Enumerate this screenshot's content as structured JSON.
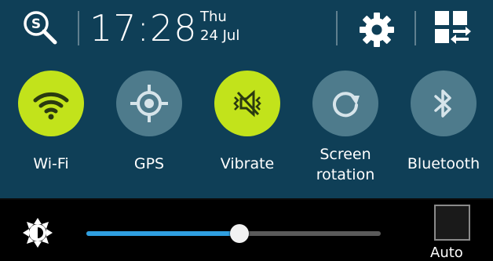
{
  "header": {
    "time": "17:28",
    "day": "Thu",
    "date": "24 Jul",
    "icons": [
      "search-icon",
      "settings-gear-icon",
      "edit-tiles-icon"
    ]
  },
  "quick_settings": [
    {
      "label": "Wi-Fi",
      "icon": "wifi-icon",
      "enabled": true
    },
    {
      "label": "GPS",
      "icon": "gps-icon",
      "enabled": false
    },
    {
      "label": "Vibrate",
      "icon": "vibrate-icon",
      "enabled": true
    },
    {
      "label_line1": "Screen",
      "label_line2": "rotation",
      "icon": "screen-rotation-icon",
      "enabled": false
    },
    {
      "label": "Bluetooth",
      "icon": "bluetooth-icon",
      "enabled": false
    }
  ],
  "brightness": {
    "icon": "brightness-icon",
    "level_fraction": 0.52,
    "auto_label": "Auto",
    "auto_checked": false
  },
  "colors": {
    "panel_bg": "#0f3f57",
    "active_tile": "#c2e31b",
    "inactive_tile": "#4e7b8c",
    "slider_fill": "#2f9fe0"
  }
}
